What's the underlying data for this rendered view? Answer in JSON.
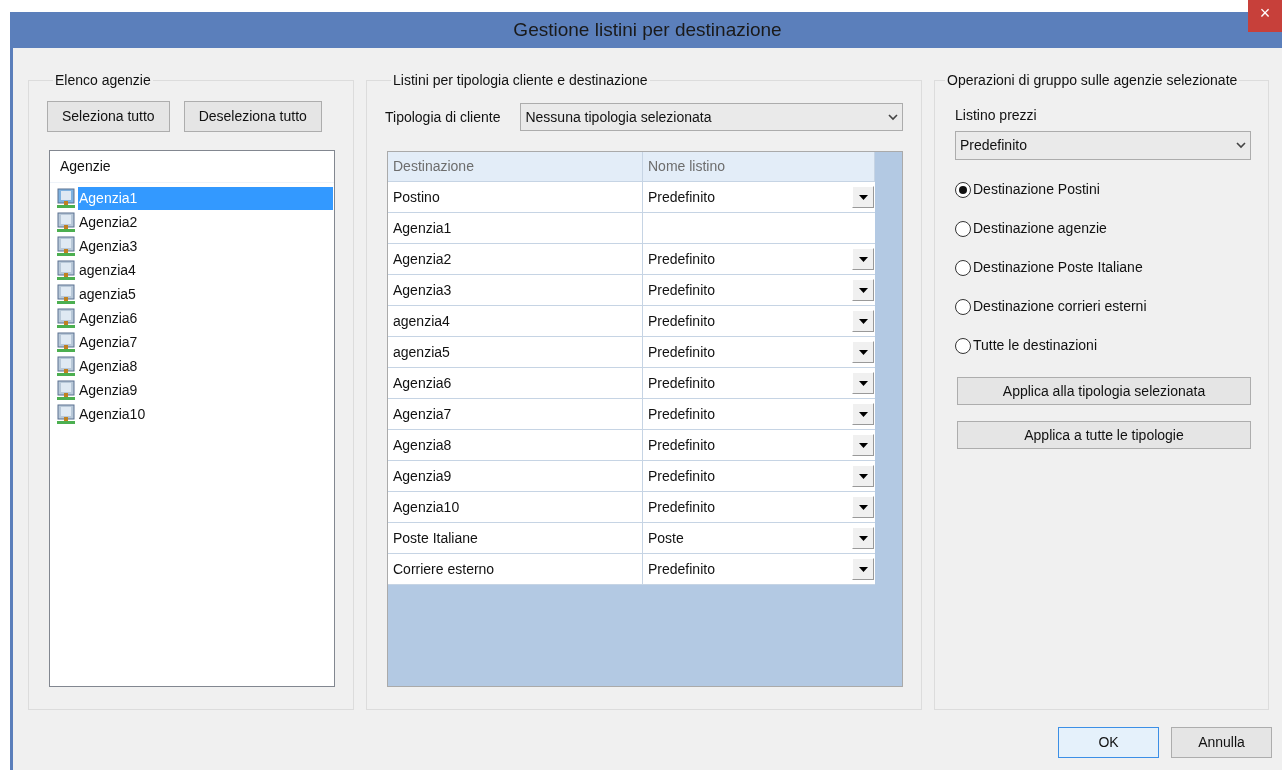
{
  "window": {
    "title": "Gestione listini per destinazione",
    "close": "×"
  },
  "agencies_group": {
    "title": "Elenco agenzie",
    "buttons": [
      "Seleziona tutto",
      "Deseleziona tutto"
    ],
    "list_header": "Agenzie",
    "items": [
      {
        "label": "Agenzia1",
        "selected": true
      },
      {
        "label": "Agenzia2",
        "selected": false
      },
      {
        "label": "Agenzia3",
        "selected": false
      },
      {
        "label": "agenzia4",
        "selected": false
      },
      {
        "label": "agenzia5",
        "selected": false
      },
      {
        "label": "Agenzia6",
        "selected": false
      },
      {
        "label": "Agenzia7",
        "selected": false
      },
      {
        "label": "Agenzia8",
        "selected": false
      },
      {
        "label": "Agenzia9",
        "selected": false
      },
      {
        "label": "Agenzia10",
        "selected": false
      }
    ]
  },
  "listini_group": {
    "title": "Listini per tipologia cliente e destinazione",
    "client_type_label": "Tipologia di cliente",
    "client_type_value": "Nessuna tipologia selezionata",
    "table": {
      "columns": [
        "Destinazione",
        "Nome listino"
      ],
      "rows": [
        {
          "destination": "Postino",
          "listino": "Predefinito",
          "dropdown": true
        },
        {
          "destination": "Agenzia1",
          "dropdown": false
        },
        {
          "destination": "Agenzia2",
          "listino": "Predefinito",
          "dropdown": true
        },
        {
          "destination": "Agenzia3",
          "listino": "Predefinito",
          "dropdown": true
        },
        {
          "destination": "agenzia4",
          "listino": "Predefinito",
          "dropdown": true
        },
        {
          "destination": "agenzia5",
          "listino": "Predefinito",
          "dropdown": true
        },
        {
          "destination": "Agenzia6",
          "listino": "Predefinito",
          "dropdown": true
        },
        {
          "destination": "Agenzia7",
          "listino": "Predefinito",
          "dropdown": true
        },
        {
          "destination": "Agenzia8",
          "listino": "Predefinito",
          "dropdown": true
        },
        {
          "destination": "Agenzia9",
          "listino": "Predefinito",
          "dropdown": true
        },
        {
          "destination": "Agenzia10",
          "listino": "Predefinito",
          "dropdown": true
        },
        {
          "destination": "Poste Italiane",
          "listino": "Poste",
          "dropdown": true
        },
        {
          "destination": "Corriere esterno",
          "listino": "Predefinito",
          "dropdown": true
        }
      ]
    }
  },
  "group_ops": {
    "title": "Operazioni di gruppo sulle agenzie selezionate",
    "price_list_label": "Listino prezzi",
    "price_list_value": "Predefinito",
    "radios": [
      {
        "label": "Destinazione Postini",
        "selected": true
      },
      {
        "label": "Destinazione agenzie",
        "selected": false
      },
      {
        "label": "Destinazione Poste Italiane",
        "selected": false
      },
      {
        "label": "Destinazione corrieri esterni",
        "selected": false
      },
      {
        "label": "Tutte le destinazioni",
        "selected": false
      }
    ],
    "buttons": [
      "Applica alla tipologia selezionata",
      "Applica a tutte le tipologie"
    ]
  },
  "footer_buttons": [
    {
      "label": "OK",
      "default": true
    },
    {
      "label": "Annulla",
      "default": false
    }
  ]
}
